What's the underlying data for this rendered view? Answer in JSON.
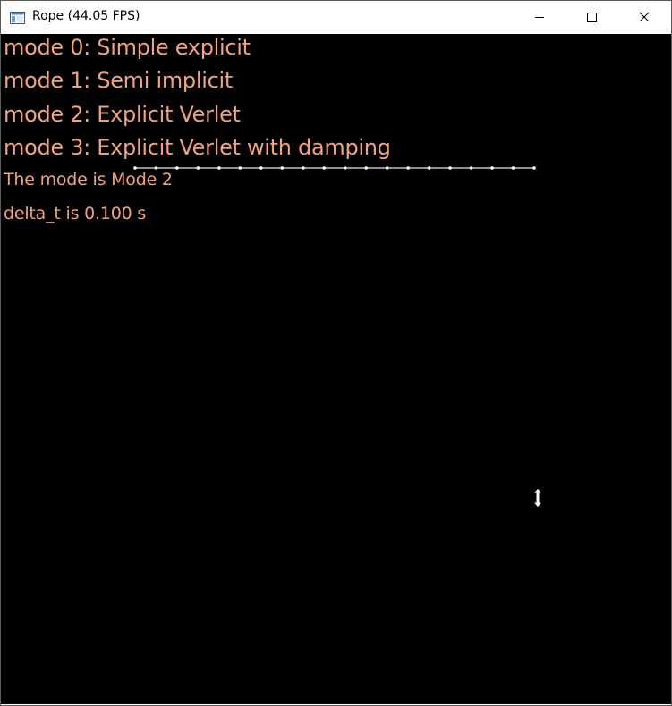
{
  "window": {
    "title": "Rope (44.05 FPS)",
    "icons": {
      "app": "app-window-icon",
      "minimize": "minimize-icon",
      "maximize": "maximize-icon",
      "close": "close-icon"
    }
  },
  "overlay": {
    "modes": [
      "mode 0: Simple explicit",
      "mode 1: Semi implicit",
      "mode 2: Explicit Verlet",
      "mode 3: Explicit Verlet with damping"
    ],
    "current_mode": "The mode is Mode 2",
    "delta_t": "delta_t is 0.100 s"
  },
  "scene": {
    "background_color": "#000000",
    "text_color": "#f0a37c",
    "rope_color": "#ffffff",
    "rope_node_count": 20,
    "cursor_icon": "resize-vertical-cursor-icon"
  }
}
